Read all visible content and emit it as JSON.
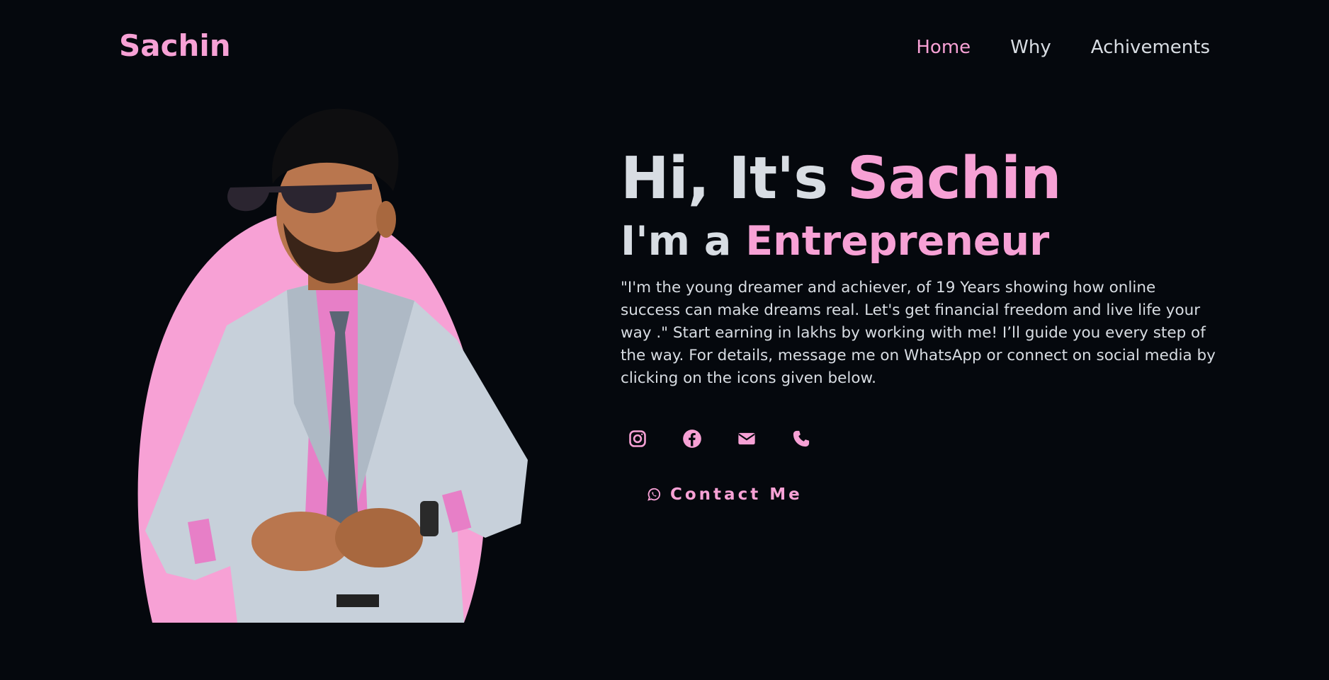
{
  "header": {
    "logo": "Sachin",
    "nav": [
      {
        "label": "Home",
        "active": true
      },
      {
        "label": "Why",
        "active": false
      },
      {
        "label": "Achivements",
        "active": false
      }
    ]
  },
  "hero": {
    "greeting_prefix": "Hi, It's ",
    "greeting_name": "Sachin",
    "role_prefix": "I'm a ",
    "role": "Entrepreneur",
    "bio": "\"I'm the young dreamer and achiever, of 19 Years showing how online success can make dreams real. Let's get financial freedom and live life your way .\" Start earning in lakhs by working with me! I’ll guide you every step of the way. For details, message me on WhatsApp or connect on social media by clicking on the icons given below.",
    "socials": [
      "instagram-icon",
      "facebook-icon",
      "email-icon",
      "phone-icon"
    ],
    "contact_button": "Contact Me"
  },
  "colors": {
    "background": "#05080d",
    "accent": "#f7a1d5",
    "text": "#d8dde3",
    "suit": "#c7d0da",
    "shirt": "#e77fc7",
    "tie": "#5b6675",
    "skin": "#b9764e"
  }
}
